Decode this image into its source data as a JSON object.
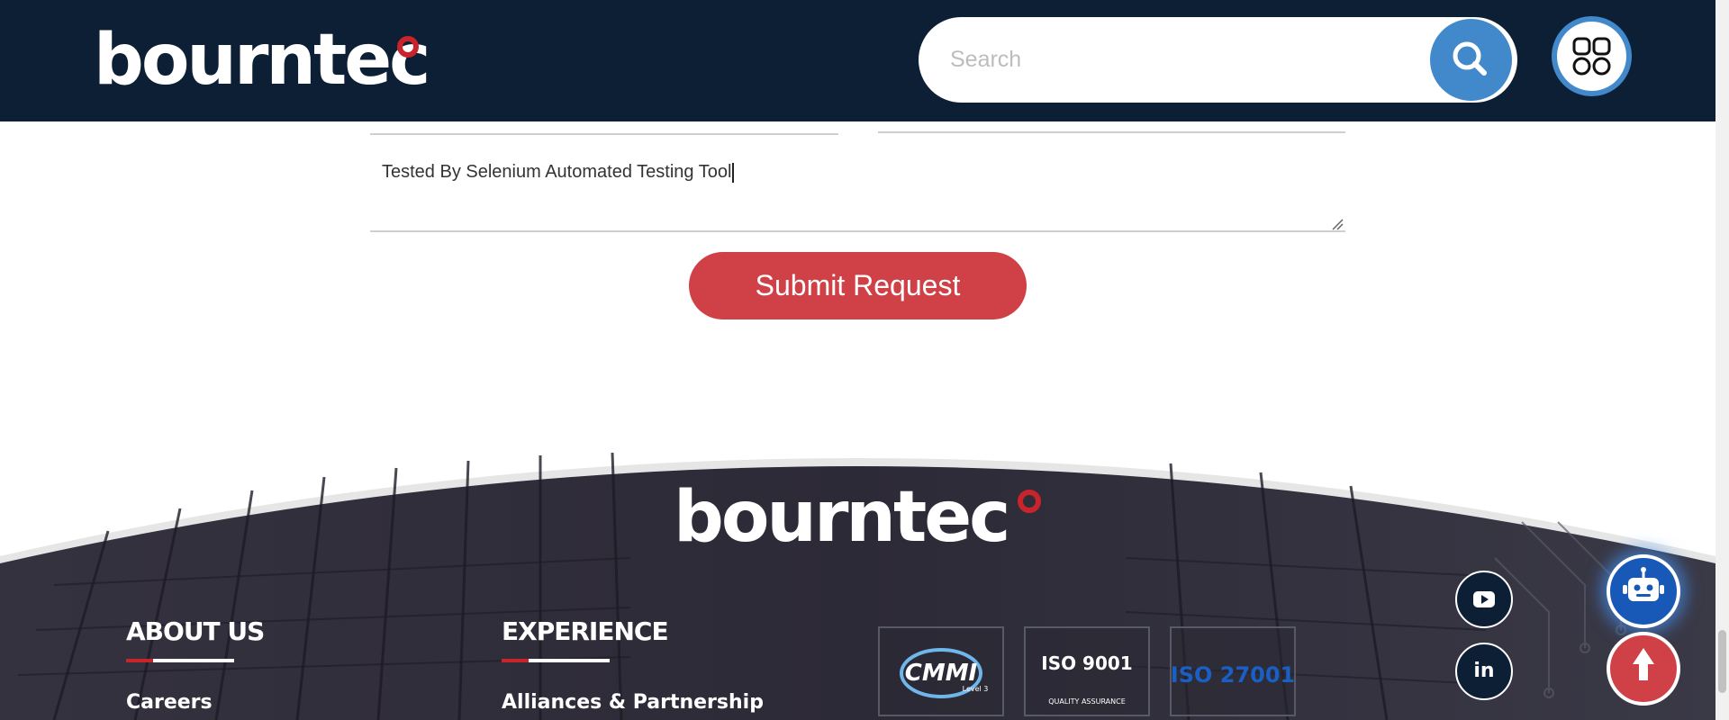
{
  "header": {
    "logo_text": "bourntec",
    "search_placeholder": "Search",
    "search_icon": "search-icon",
    "apps_icon": "apps-grid-icon"
  },
  "form": {
    "message_value": "Tested By Selenium Automated Testing Tool",
    "submit_label": "Submit Request"
  },
  "footer": {
    "logo_text": "bourntec",
    "columns": [
      {
        "title": "ABOUT US",
        "link": "Careers"
      },
      {
        "title": "EXPERIENCE",
        "link": "Alliances & Partnership"
      }
    ],
    "certifications": [
      {
        "name": "CMMI",
        "sub": "Level 3"
      },
      {
        "name": "ISO 9001",
        "sub": "QUALITY ASSURANCE"
      },
      {
        "name": "ISO 27001",
        "sub": ""
      }
    ],
    "social": [
      {
        "icon": "youtube-icon"
      },
      {
        "icon": "linkedin-icon",
        "label": "in"
      }
    ]
  },
  "floating": {
    "chatbot_icon": "robot-icon",
    "back_to_top_icon": "arrow-up-icon"
  },
  "colors": {
    "header_bg": "#0d1f35",
    "accent_blue": "#4189cb",
    "accent_red": "#cf4147",
    "footer_bg": "#2a2836"
  }
}
